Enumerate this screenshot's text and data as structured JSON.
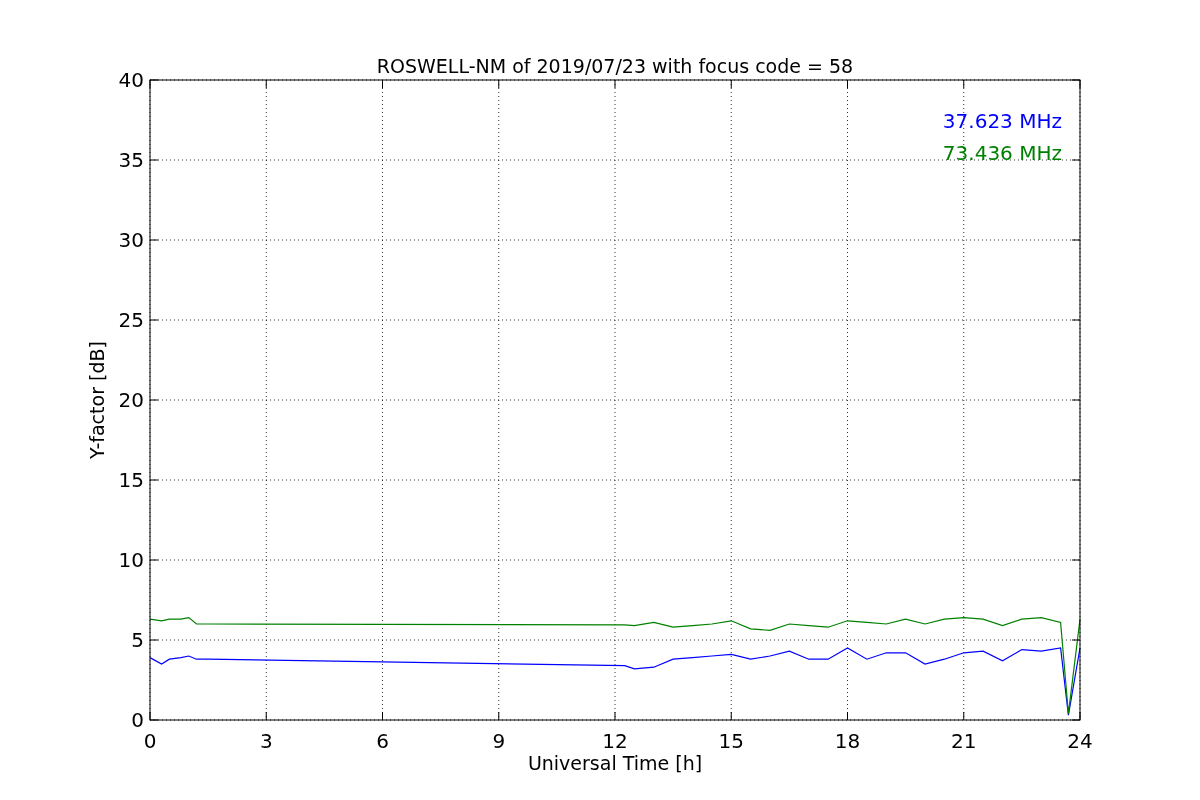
{
  "chart_data": {
    "type": "line",
    "title": "ROSWELL-NM of 2019/07/23 with focus code = 58",
    "xlabel": "Universal Time [h]",
    "ylabel": "Y-factor [dB]",
    "x": [
      0,
      0.3,
      0.5,
      0.8,
      1,
      1.2,
      1.5,
      12.25,
      12.5,
      13,
      13.5,
      14,
      14.5,
      15,
      15.5,
      16,
      16.5,
      17,
      17.5,
      18,
      18.5,
      19,
      19.5,
      20,
      20.5,
      21,
      21.5,
      22,
      22.5,
      23,
      23.5,
      23.7,
      24
    ],
    "series": [
      {
        "name": "37.623 MHz",
        "color": "#0000ff",
        "values": [
          3.9,
          3.5,
          3.8,
          3.9,
          4.0,
          3.8,
          3.8,
          3.4,
          3.2,
          3.3,
          3.8,
          3.9,
          4.0,
          4.1,
          3.8,
          4.0,
          4.3,
          3.8,
          3.8,
          4.5,
          3.8,
          4.2,
          4.2,
          3.5,
          3.8,
          4.2,
          4.3,
          3.7,
          4.4,
          4.3,
          4.5,
          0.3,
          4.5
        ]
      },
      {
        "name": "73.436 MHz",
        "color": "#008000",
        "values": [
          6.3,
          6.2,
          6.3,
          6.3,
          6.4,
          6.0,
          6.0,
          5.95,
          5.9,
          6.1,
          5.8,
          5.9,
          6.0,
          6.2,
          5.7,
          5.6,
          6.0,
          5.9,
          5.8,
          6.2,
          6.1,
          6.0,
          6.3,
          6.0,
          6.3,
          6.4,
          6.3,
          5.9,
          6.3,
          6.4,
          6.1,
          0.4,
          6.3
        ]
      }
    ],
    "xlim": [
      0,
      24
    ],
    "ylim": [
      0,
      40
    ],
    "xticks": [
      0,
      3,
      6,
      9,
      12,
      15,
      18,
      21,
      24
    ],
    "yticks": [
      0,
      5,
      10,
      15,
      20,
      25,
      30,
      35,
      40
    ],
    "grid": true
  }
}
